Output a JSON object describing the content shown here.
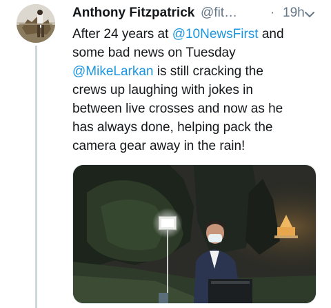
{
  "tweet": {
    "display_name": "Anthony Fitzpatrick",
    "handle": "@fit…",
    "separator": "·",
    "timestamp": "19h",
    "caret_icon": "chevron-down-icon",
    "text": {
      "line1_a": "After 24 years at ",
      "line1_mention": "@10NewsFirst",
      "line1_b": " and",
      "line2": "some bad news on Tuesday",
      "line3_mention": "@MikeLarkan",
      "line3_b": " is still cracking the",
      "line4": "crews up laughing with jokes in",
      "line5": "between live crosses and now as he",
      "line6": "has always done, helping pack the",
      "line7": "camera gear away in the rain!"
    },
    "accent_color": "#1b95e0"
  }
}
